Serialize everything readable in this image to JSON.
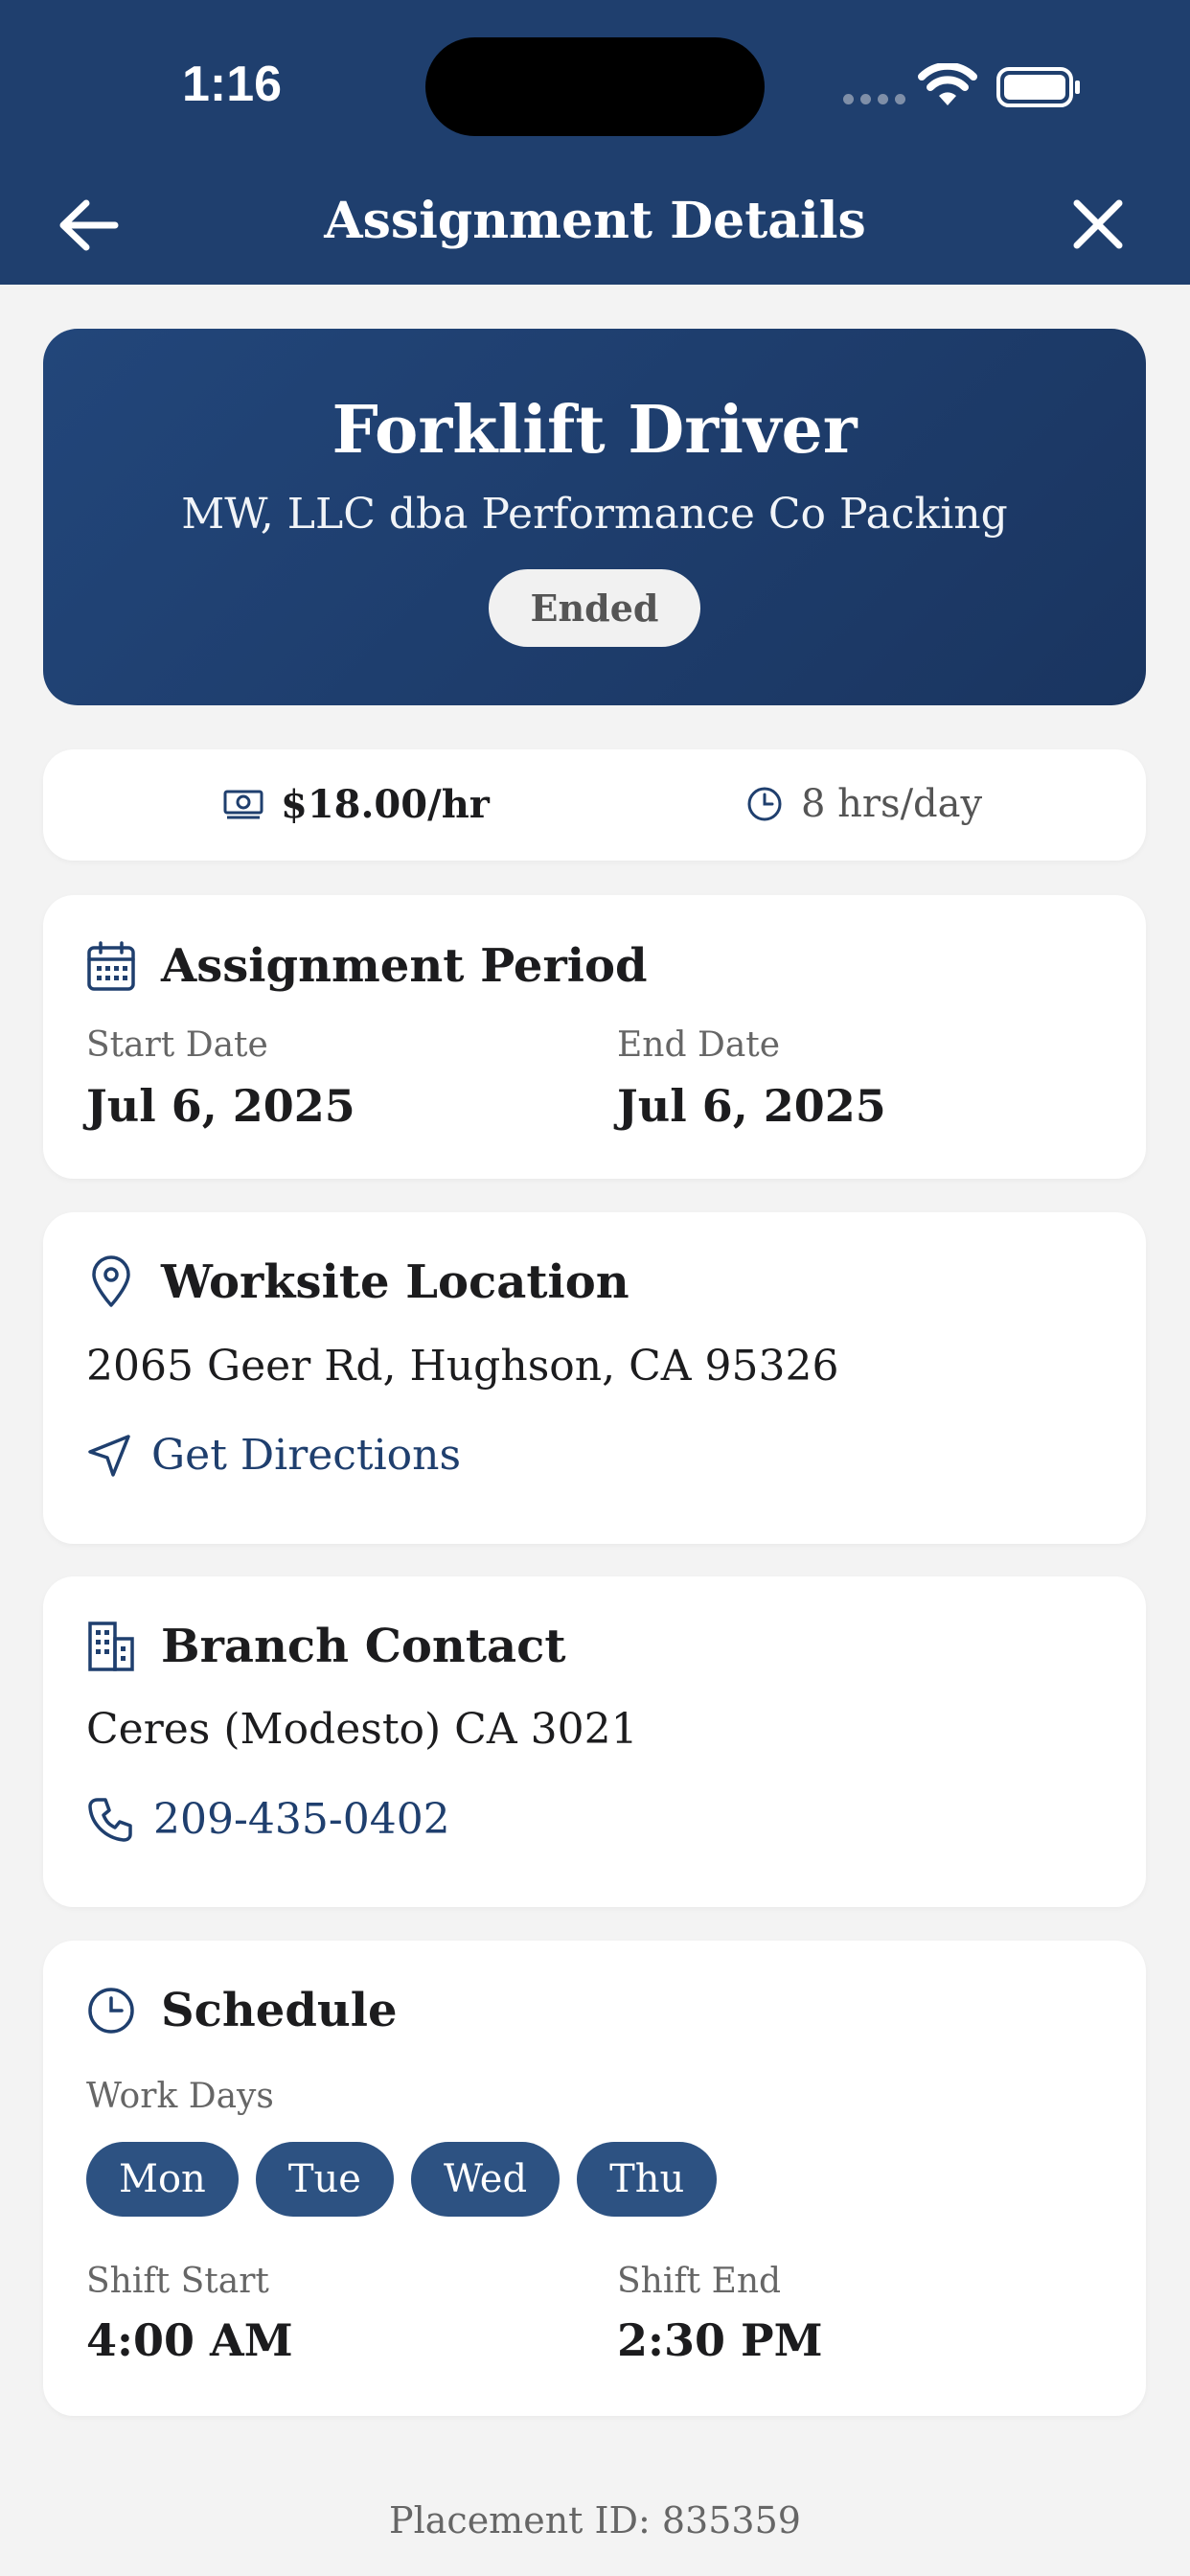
{
  "status_bar": {
    "time": "1:16"
  },
  "nav": {
    "title": "Assignment Details"
  },
  "hero": {
    "job_title": "Forklift Driver",
    "company": "MW, LLC dba Performance Co Packing",
    "status": "Ended"
  },
  "pay": {
    "rate": "$18.00/hr",
    "hours": "8 hrs/day"
  },
  "period": {
    "heading": "Assignment Period",
    "start_label": "Start Date",
    "start_value": "Jul 6, 2025",
    "end_label": "End Date",
    "end_value": "Jul 6, 2025"
  },
  "location": {
    "heading": "Worksite Location",
    "address": "2065 Geer Rd, Hughson, CA 95326",
    "directions_label": "Get Directions"
  },
  "branch": {
    "heading": "Branch Contact",
    "name": "Ceres (Modesto) CA 3021",
    "phone": "209-435-0402"
  },
  "schedule": {
    "heading": "Schedule",
    "work_days_label": "Work Days",
    "days": [
      "Mon",
      "Tue",
      "Wed",
      "Thu"
    ],
    "shift_start_label": "Shift Start",
    "shift_start_value": "4:00 AM",
    "shift_end_label": "Shift End",
    "shift_end_value": "2:30 PM"
  },
  "footer": {
    "placement_id": "Placement ID: 835359"
  },
  "colors": {
    "primary": "#1f3f6e",
    "day_chip": "#2d5282",
    "background": "#f3f3f3"
  }
}
